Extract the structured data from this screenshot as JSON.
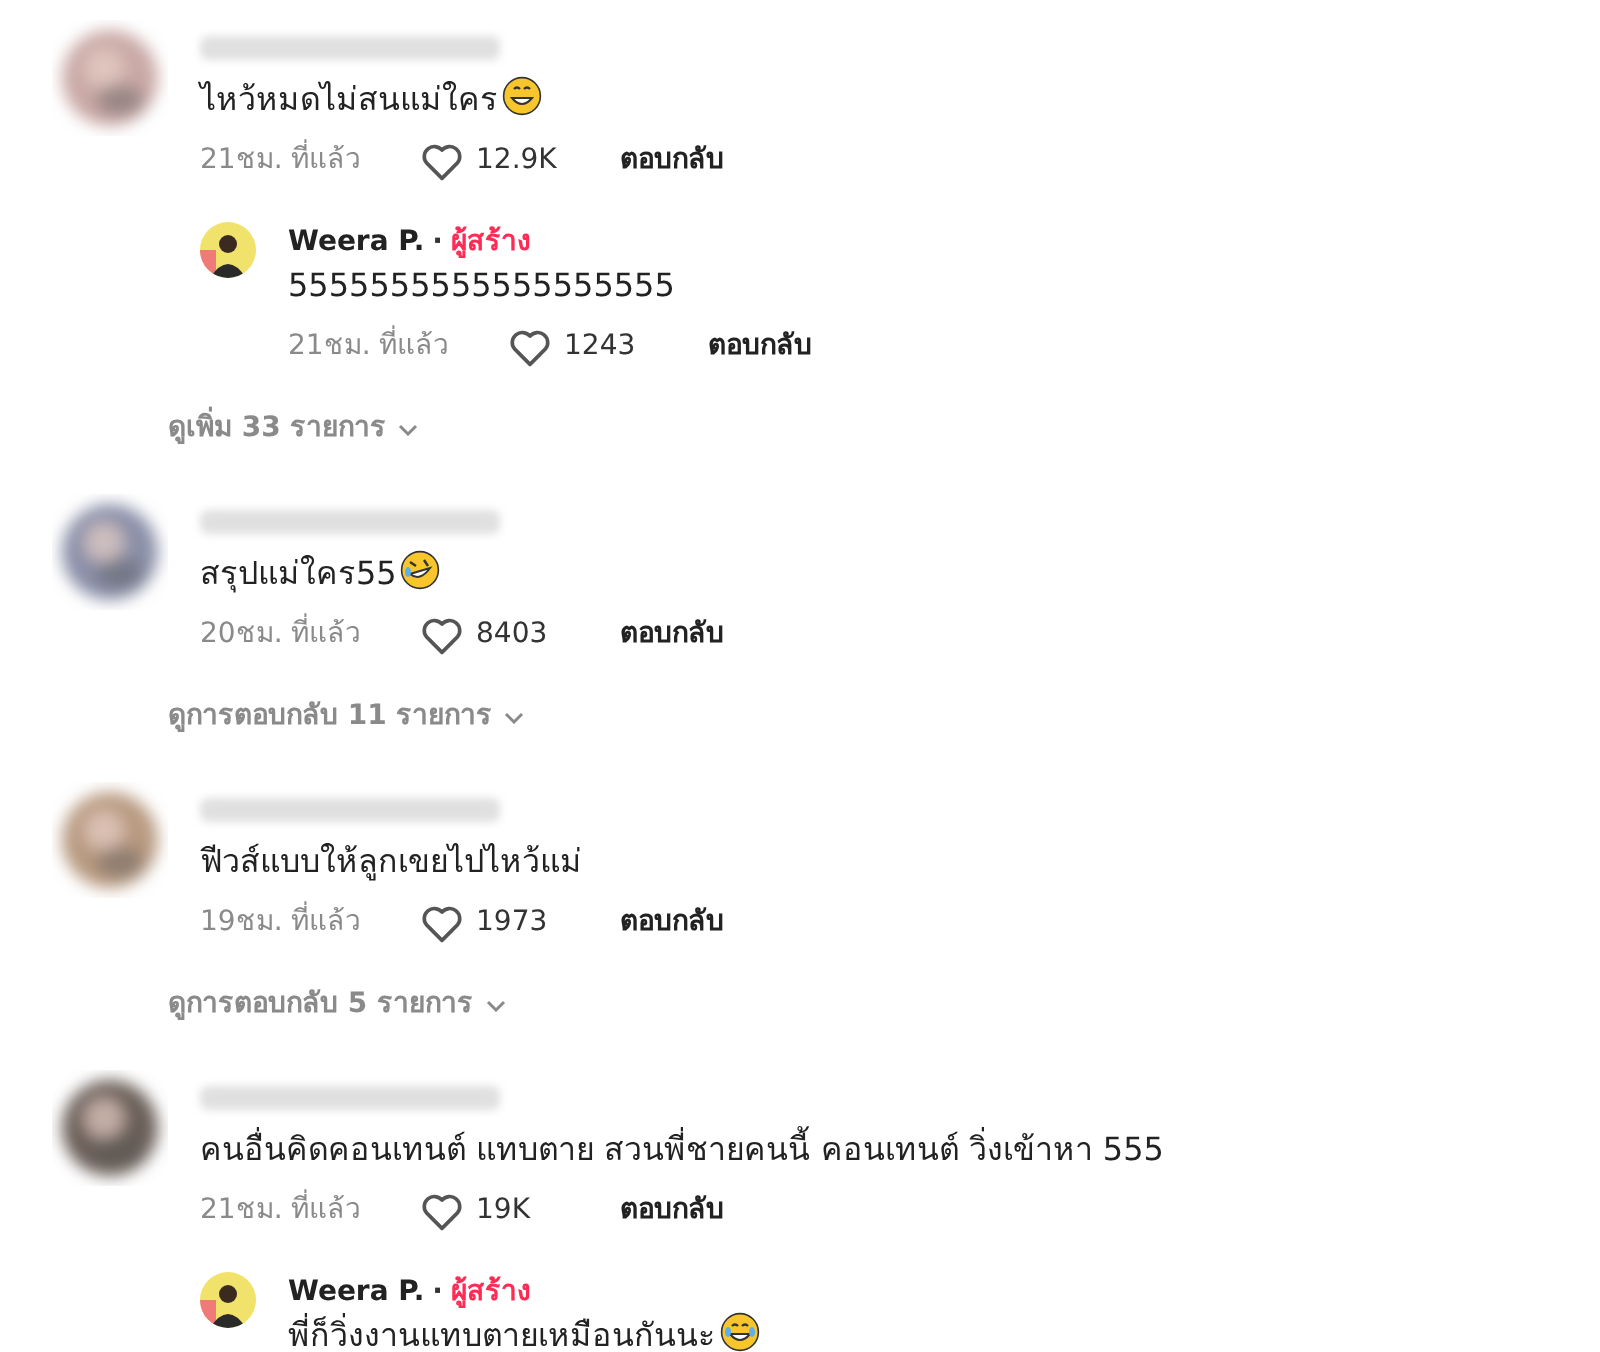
{
  "comments": [
    {
      "text": "ไหว้หมดไม่สนแม่ใคร",
      "emoji": {
        "kind": "grin"
      },
      "time": "21ชม. ที่แล้ว",
      "likes": "12.9K",
      "reply_label": "ตอบกลับ",
      "replies": [
        {
          "author": "Weera P.",
          "separator": "·",
          "badge": "ผู้สร้าง",
          "text": "5555555555555555555",
          "time": "21ชม. ที่แล้ว",
          "likes": "1243",
          "reply_label": "ตอบกลับ"
        }
      ],
      "more_label": "ดูเพิ่ม 33 รายการ"
    },
    {
      "text": "สรุปแม่ใคร55",
      "emoji": {
        "kind": "rofl"
      },
      "time": "20ชม. ที่แล้ว",
      "likes": "8403",
      "reply_label": "ตอบกลับ",
      "more_label": "ดูการตอบกลับ 11 รายการ"
    },
    {
      "text": "ฟีวส์แบบให้ลูกเขยไปไหว้แม่",
      "time": "19ชม. ที่แล้ว",
      "likes": "1973",
      "reply_label": "ตอบกลับ",
      "more_label": "ดูการตอบกลับ 5 รายการ"
    },
    {
      "text": "คนอื่นคิดคอนเทนต์ แทบตาย สวนพี่ชายคนนี้ คอนเทนต์ วิ่งเข้าหา 555",
      "time": "21ชม. ที่แล้ว",
      "likes": "19K",
      "reply_label": "ตอบกลับ",
      "replies": [
        {
          "author": "Weera P.",
          "separator": "·",
          "badge": "ผู้สร้าง",
          "text": "พี่ก็วิ่งงานแทบตายเหมือนกันนะ",
          "emoji": {
            "kind": "joy"
          }
        }
      ]
    }
  ]
}
